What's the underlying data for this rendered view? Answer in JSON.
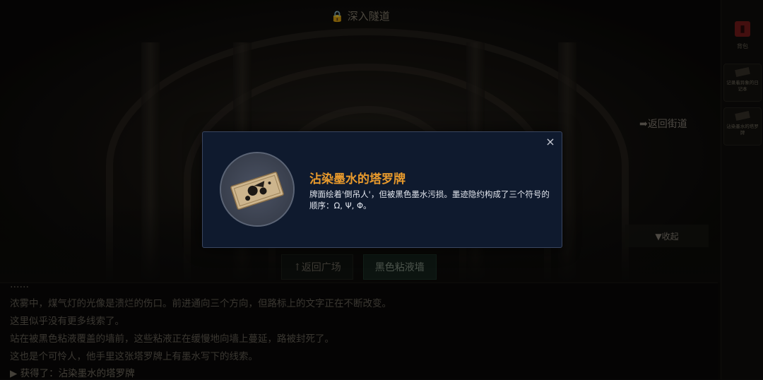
{
  "scene": {
    "title": "深入隧道",
    "return_street": "➡返回街道",
    "collapse": "▼收起",
    "choices": [
      "↑返回广场",
      "黑色粘液墙"
    ]
  },
  "log": {
    "lines": [
      "……",
      "浓雾中，煤气灯的光像是溃烂的伤口。前进通向三个方向，但路标上的文字正在不断改变。",
      "这里似乎没有更多线索了。",
      "站在被黑色粘液覆盖的墙前，这些粘液正在缓慢地向墙上蔓延，路被封死了。",
      "这也是个可怜人，他手里这张塔罗牌上有墨水写下的线索。",
      "▶ 获得了：沾染墨水的塔罗牌"
    ]
  },
  "sidebar": {
    "journal_label": "背包",
    "items": [
      "记录着异象的日记本",
      "沾染墨水的塔罗牌"
    ]
  },
  "modal": {
    "close": "×",
    "icon": "tarot-card-icon",
    "title": "沾染墨水的塔罗牌",
    "description": "牌面绘着'倒吊人'，但被黑色墨水污损。墨迹隐约构成了三个符号的顺序：Ω, Ψ, Φ。"
  },
  "colors": {
    "modal_bg": "#0f1a2e",
    "title_orange": "#e89a2c",
    "journal_red": "#7a1c1c"
  }
}
